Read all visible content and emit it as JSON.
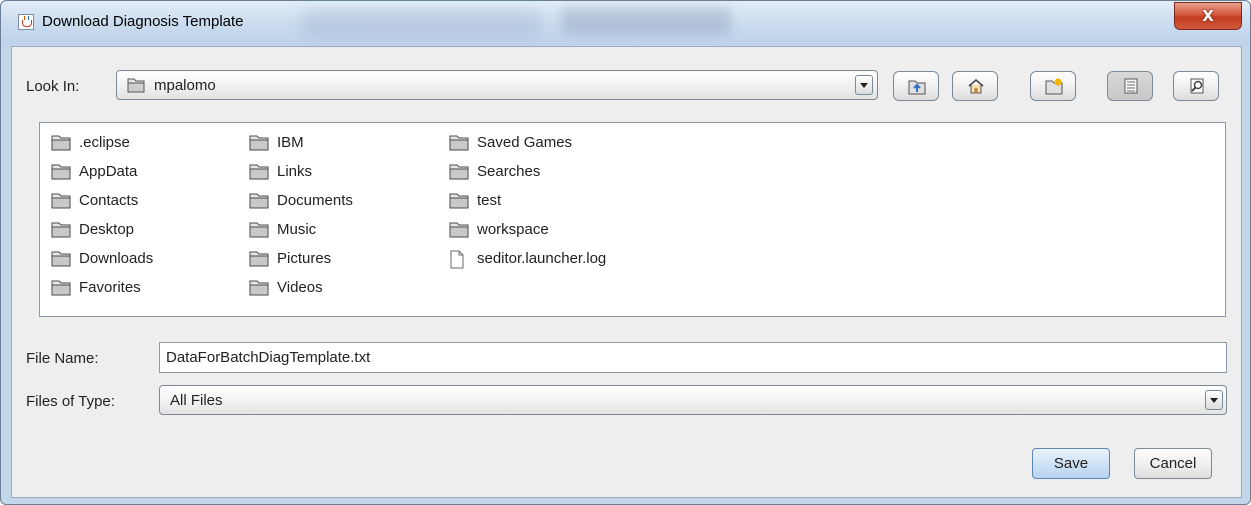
{
  "window": {
    "title": "Download Diagnosis Template",
    "close_glyph": "X"
  },
  "look_in": {
    "label": "Look In:",
    "value": "mpalomo"
  },
  "toolbar": {
    "icons": [
      "up-one-level-icon",
      "home-icon",
      "new-folder-icon",
      "list-view-icon",
      "details-view-icon"
    ]
  },
  "files": {
    "columns": [
      [
        {
          "name": ".eclipse",
          "type": "folder"
        },
        {
          "name": "AppData",
          "type": "folder"
        },
        {
          "name": "Contacts",
          "type": "folder"
        },
        {
          "name": "Desktop",
          "type": "folder"
        },
        {
          "name": "Downloads",
          "type": "folder"
        },
        {
          "name": "Favorites",
          "type": "folder"
        }
      ],
      [
        {
          "name": "IBM",
          "type": "folder"
        },
        {
          "name": "Links",
          "type": "folder"
        },
        {
          "name": "Documents",
          "type": "folder"
        },
        {
          "name": "Music",
          "type": "folder"
        },
        {
          "name": "Pictures",
          "type": "folder"
        },
        {
          "name": "Videos",
          "type": "folder"
        }
      ],
      [
        {
          "name": "Saved Games",
          "type": "folder"
        },
        {
          "name": "Searches",
          "type": "folder"
        },
        {
          "name": "test",
          "type": "folder"
        },
        {
          "name": "workspace",
          "type": "folder"
        },
        {
          "name": "seditor.launcher.log",
          "type": "file"
        }
      ]
    ]
  },
  "file_name": {
    "label": "File Name:",
    "value": "DataForBatchDiagTemplate.txt"
  },
  "files_of_type": {
    "label": "Files of Type:",
    "value": "All Files"
  },
  "buttons": {
    "save": "Save",
    "cancel": "Cancel"
  },
  "colors": {
    "title_bar": "#c9dbee",
    "close": "#c23b20",
    "dialog_bg": "#eeeeee",
    "default_button": "#cfe2f6"
  }
}
